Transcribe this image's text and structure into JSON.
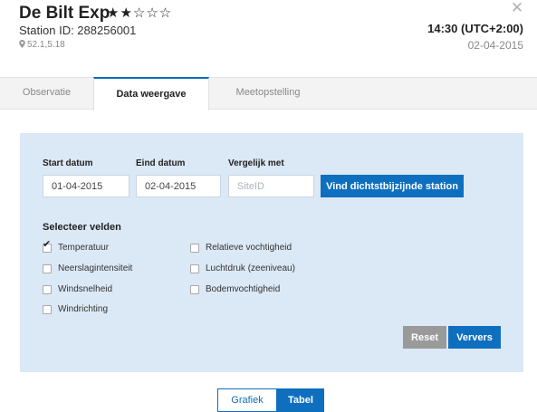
{
  "header": {
    "title": "De Bilt Exp",
    "rating_stars": "★★☆☆☆",
    "rating_value": 2,
    "rating_max": 5,
    "station_id": "Station ID: 288256001",
    "coordinates": "52.1,5.18",
    "time": "14:30 (UTC+2:00)",
    "date": "02-04-2015",
    "close_glyph": "✕"
  },
  "tabs": [
    {
      "label": "Observatie",
      "active": false
    },
    {
      "label": "Data weergave",
      "active": true
    },
    {
      "label": "Meetopstelling",
      "active": false
    }
  ],
  "form": {
    "start_label": "Start datum",
    "start_value": "01-04-2015",
    "end_label": "Eind datum",
    "end_value": "02-04-2015",
    "compare_label": "Vergelijk met",
    "compare_placeholder": "SiteID",
    "find_button": "Vind dichtstbijzijnde station",
    "fields_title": "Selecteer velden",
    "fields": [
      {
        "label": "Temperatuur",
        "checked": true
      },
      {
        "label": "Neerslagintensiteit",
        "checked": false
      },
      {
        "label": "Windsnelheid",
        "checked": false
      },
      {
        "label": "Windrichting",
        "checked": false
      },
      {
        "label": "Relatieve vochtigheid",
        "checked": false
      },
      {
        "label": "Luchtdruk (zeeniveau)",
        "checked": false
      },
      {
        "label": "Bodemvochtigheid",
        "checked": false
      }
    ],
    "reset_button": "Reset",
    "refresh_button": "Ververs"
  },
  "view_toggle": {
    "graph": "Grafiek",
    "table": "Tabel",
    "selected": "Tabel"
  },
  "colors": {
    "accent": "#0f6fbf",
    "panel_bg": "#dbe8f5",
    "reset_bg": "#9a9a9a"
  }
}
